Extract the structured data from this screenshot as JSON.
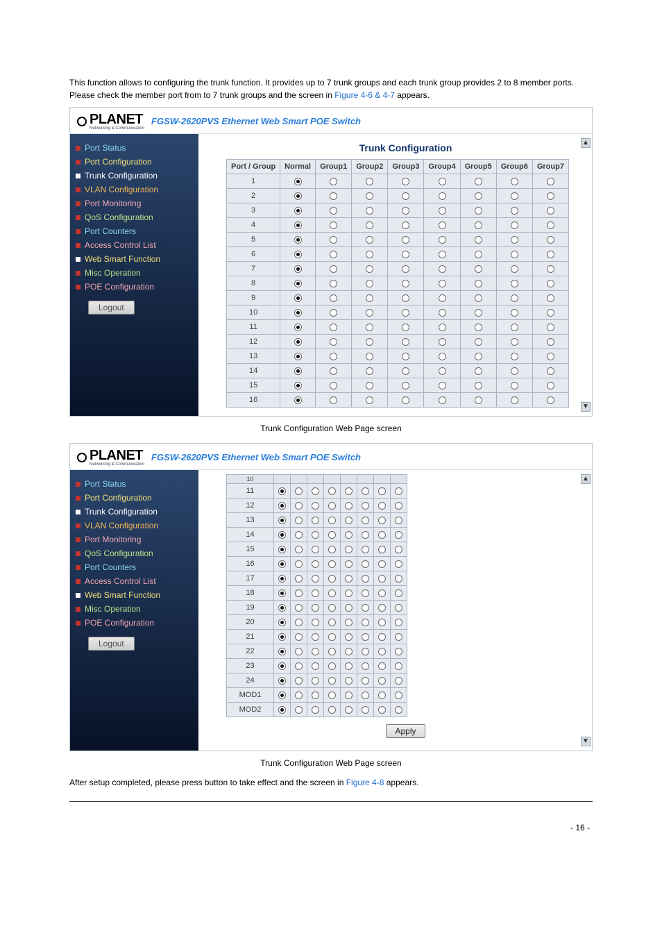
{
  "intro": {
    "p1a": "This function allows to configuring the trunk function. It provides up to 7 trunk groups and each trunk group provides 2 to 8 member ports. Please check the member port from ",
    "p1b": " to 7 trunk groups and the screen in ",
    "ref1": "Figure 4-6 & 4-7",
    "p1c": " appears."
  },
  "device_title": "FGSW-2620PVS Ethernet Web Smart POE Switch",
  "logo_text": "PLANET",
  "logo_sub": "Networking & Communication",
  "sidebar": {
    "items": [
      {
        "label": "Port Status",
        "sq": "sq-red",
        "cls": "c-cyan"
      },
      {
        "label": "Port Configuration",
        "sq": "sq-red",
        "cls": "c-yellow"
      },
      {
        "label": "Trunk Configuration",
        "sq": "sq-white",
        "cls": "c-white"
      },
      {
        "label": "VLAN Configuration",
        "sq": "sq-red",
        "cls": "c-orange"
      },
      {
        "label": "Port Monitoring",
        "sq": "sq-red",
        "cls": "c-pink"
      },
      {
        "label": "QoS Configuration",
        "sq": "sq-red",
        "cls": "c-green"
      },
      {
        "label": "Port Counters",
        "sq": "sq-red",
        "cls": "c-cyan"
      },
      {
        "label": "Access Control List",
        "sq": "sq-red",
        "cls": "c-pink"
      },
      {
        "label": "Web Smart Function",
        "sq": "sq-white",
        "cls": "c-yellow"
      },
      {
        "label": "Misc Operation",
        "sq": "sq-red",
        "cls": "c-green"
      },
      {
        "label": "POE Configuration",
        "sq": "sq-red",
        "cls": "c-pink"
      }
    ],
    "logout": "Logout"
  },
  "table1": {
    "title": "Trunk Configuration",
    "headers": [
      "Port / Group",
      "Normal",
      "Group1",
      "Group2",
      "Group3",
      "Group4",
      "Group5",
      "Group6",
      "Group7"
    ],
    "rows": [
      "1",
      "2",
      "3",
      "4",
      "5",
      "6",
      "7",
      "8",
      "9",
      "10",
      "11",
      "12",
      "13",
      "14",
      "15",
      "16"
    ]
  },
  "caption1": "Trunk Configuration Web Page screen",
  "table2": {
    "header_row": [
      "10",
      "",
      "",
      "",
      "",
      "",
      "",
      "",
      ""
    ],
    "rows": [
      "11",
      "12",
      "13",
      "14",
      "15",
      "16",
      "17",
      "18",
      "19",
      "20",
      "21",
      "22",
      "23",
      "24",
      "MOD1",
      "MOD2"
    ],
    "apply": "Apply"
  },
  "caption2": "Trunk Configuration Web Page screen",
  "after": {
    "a": "After setup completed, please press ",
    "b": " button to take effect and the screen in ",
    "ref": "Figure 4-8",
    "c": " appears."
  },
  "page_num": "- 16 -"
}
